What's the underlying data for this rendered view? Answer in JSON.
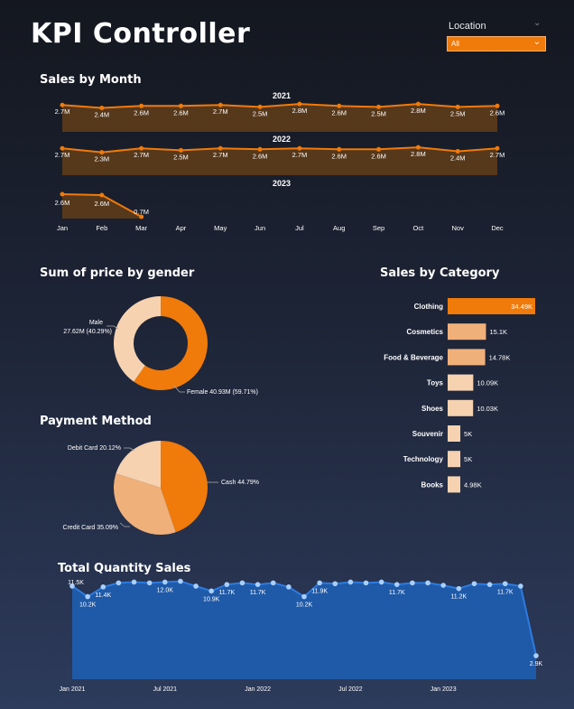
{
  "header": {
    "title": "KPI Controller",
    "location_label": "Location",
    "location_value": "All"
  },
  "colors": {
    "accent": "#f07a0a",
    "light_orange": "#f0b07a",
    "peach": "#f6d2b0",
    "area_fill": "#5a3a1a",
    "blue_line": "#2d7be0",
    "blue_fill": "#1f5aa8"
  },
  "sales_by_month": {
    "title": "Sales by Month",
    "months": [
      "Jan",
      "Feb",
      "Mar",
      "Apr",
      "May",
      "Jun",
      "Jul",
      "Aug",
      "Sep",
      "Oct",
      "Nov",
      "Dec"
    ],
    "years": [
      {
        "year": "2021",
        "values": [
          2.7,
          2.4,
          2.6,
          2.6,
          2.7,
          2.5,
          2.8,
          2.6,
          2.5,
          2.8,
          2.5,
          2.6
        ],
        "labels": [
          "2.7M",
          "2.4M",
          "2.6M",
          "2.6M",
          "2.7M",
          "2.5M",
          "2.8M",
          "2.6M",
          "2.5M",
          "2.8M",
          "2.5M",
          "2.6M"
        ]
      },
      {
        "year": "2022",
        "values": [
          2.7,
          2.3,
          2.7,
          2.5,
          2.7,
          2.6,
          2.7,
          2.6,
          2.6,
          2.8,
          2.4,
          2.7
        ],
        "labels": [
          "2.7M",
          "2.3M",
          "2.7M",
          "2.5M",
          "2.7M",
          "2.6M",
          "2.7M",
          "2.6M",
          "2.6M",
          "2.8M",
          "2.4M",
          "2.7M"
        ]
      },
      {
        "year": "2023",
        "values": [
          2.6,
          2.6,
          0.7
        ],
        "labels": [
          "2.6M",
          "2.6M",
          "0.7M"
        ]
      }
    ]
  },
  "gender": {
    "title": "Sum of price by gender",
    "male_label": "Male",
    "male_value": "27.62M (40.29%)",
    "male_share": 40.29,
    "female_label": "Female 40.93M (59.71%)",
    "female_share": 59.71
  },
  "payment": {
    "title": "Payment Method",
    "slices": [
      {
        "label": "Cash 44.79%",
        "share": 44.79
      },
      {
        "label": "Credit Card 35.09%",
        "share": 35.09
      },
      {
        "label": "Debit Card 20.12%",
        "share": 20.12
      }
    ]
  },
  "category": {
    "title": "Sales by Category",
    "items": [
      {
        "name": "Clothing",
        "value": 34.49,
        "label": "34.49K"
      },
      {
        "name": "Cosmetics",
        "value": 15.1,
        "label": "15.1K"
      },
      {
        "name": "Food & Beverage",
        "value": 14.78,
        "label": "14.78K"
      },
      {
        "name": "Toys",
        "value": 10.09,
        "label": "10.09K"
      },
      {
        "name": "Shoes",
        "value": 10.03,
        "label": "10.03K"
      },
      {
        "name": "Souvenir",
        "value": 5,
        "label": "5K"
      },
      {
        "name": "Technology",
        "value": 5,
        "label": "5K"
      },
      {
        "name": "Books",
        "value": 4.98,
        "label": "4.98K"
      }
    ]
  },
  "quantity": {
    "title": "Total Quantity Sales",
    "values": [
      11.5,
      10.2,
      11.4,
      11.9,
      12.0,
      11.9,
      12.0,
      12.1,
      11.5,
      10.9,
      11.7,
      11.9,
      11.7,
      11.9,
      11.4,
      10.2,
      11.9,
      11.8,
      12.0,
      11.9,
      12.0,
      11.7,
      11.9,
      11.9,
      11.6,
      11.2,
      11.8,
      11.7,
      11.8,
      11.5,
      2.9
    ],
    "labels": {
      "0": "11.5K",
      "1": "10.2K",
      "2": "11.4K",
      "6": "12.0K",
      "9": "10.9K",
      "10": "11.7K",
      "12": "11.7K",
      "15": "10.2K",
      "16": "11.9K",
      "21": "11.7K",
      "25": "11.2K",
      "28": "11.7K",
      "30": "2.9K"
    },
    "x_ticks": [
      {
        "index": 0,
        "label": "Jan 2021"
      },
      {
        "index": 6,
        "label": "Jul 2021"
      },
      {
        "index": 12,
        "label": "Jan 2022"
      },
      {
        "index": 18,
        "label": "Jul 2022"
      },
      {
        "index": 24,
        "label": "Jan 2023"
      }
    ]
  },
  "chart_data": [
    {
      "type": "area",
      "title": "Sales by Month",
      "categories": [
        "Jan",
        "Feb",
        "Mar",
        "Apr",
        "May",
        "Jun",
        "Jul",
        "Aug",
        "Sep",
        "Oct",
        "Nov",
        "Dec"
      ],
      "series": [
        {
          "name": "2021",
          "values": [
            2.7,
            2.4,
            2.6,
            2.6,
            2.7,
            2.5,
            2.8,
            2.6,
            2.5,
            2.8,
            2.5,
            2.6
          ]
        },
        {
          "name": "2022",
          "values": [
            2.7,
            2.3,
            2.7,
            2.5,
            2.7,
            2.6,
            2.7,
            2.6,
            2.6,
            2.8,
            2.4,
            2.7
          ]
        },
        {
          "name": "2023",
          "values": [
            2.6,
            2.6,
            0.7
          ]
        }
      ]
    },
    {
      "type": "pie",
      "title": "Sum of price by gender",
      "categories": [
        "Male",
        "Female"
      ],
      "values": [
        27.62,
        40.93
      ]
    },
    {
      "type": "pie",
      "title": "Payment Method",
      "categories": [
        "Cash",
        "Credit Card",
        "Debit Card"
      ],
      "values": [
        44.79,
        35.09,
        20.12
      ]
    },
    {
      "type": "bar",
      "title": "Sales by Category",
      "categories": [
        "Clothing",
        "Cosmetics",
        "Food & Beverage",
        "Toys",
        "Shoes",
        "Souvenir",
        "Technology",
        "Books"
      ],
      "values": [
        34.49,
        15.1,
        14.78,
        10.09,
        10.03,
        5,
        5,
        4.98
      ]
    },
    {
      "type": "area",
      "title": "Total Quantity Sales",
      "x": [
        "Jan 2021",
        "Jul 2021",
        "Jan 2022",
        "Jul 2022",
        "Jan 2023"
      ],
      "values": [
        11.5,
        10.2,
        11.4,
        11.9,
        12.0,
        11.9,
        12.0,
        12.1,
        11.5,
        10.9,
        11.7,
        11.9,
        11.7,
        11.9,
        11.4,
        10.2,
        11.9,
        11.8,
        12.0,
        11.9,
        12.0,
        11.7,
        11.9,
        11.9,
        11.6,
        11.2,
        11.8,
        11.7,
        11.8,
        11.5,
        2.9
      ]
    }
  ]
}
